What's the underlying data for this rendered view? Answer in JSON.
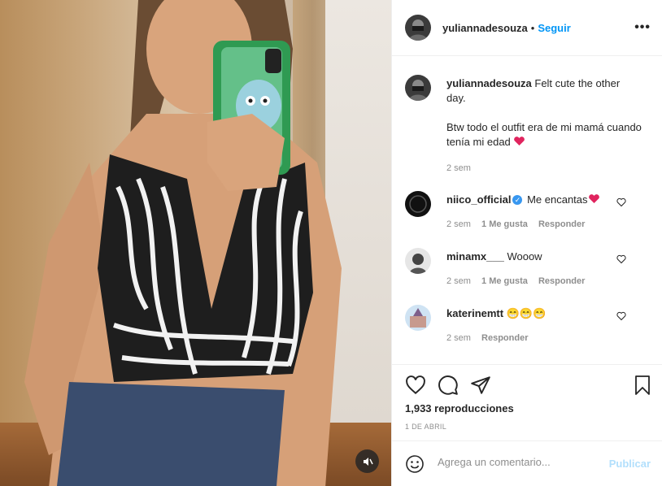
{
  "post": {
    "username": "yuliannadesouza",
    "separator": "•",
    "follow_label": "Seguir",
    "more_label": "•••"
  },
  "caption": {
    "username": "yuliannadesouza",
    "line1": "Felt cute the other day.",
    "line2": "Btw todo el outfit era de mi mamá cuando tenía mi edad",
    "time": "2 sem"
  },
  "comments": [
    {
      "username": "niico_official",
      "text": "Me encantas",
      "time": "2 sem",
      "likes": "1 Me gusta",
      "reply": "Responder",
      "verified_mark": "✓"
    },
    {
      "username": "minamx___",
      "text": "Wooow",
      "time": "2 sem",
      "likes": "1 Me gusta",
      "reply": "Responder"
    },
    {
      "username": "katerinemtt",
      "text": "😁😁😁",
      "time": "2 sem",
      "reply": "Responder"
    }
  ],
  "stats": {
    "views": "1,933 reproducciones",
    "date": "1 DE ABRIL"
  },
  "composer": {
    "placeholder": "Agrega un comentario...",
    "publish_label": "Publicar"
  },
  "colors": {
    "accent": "#0095f6",
    "publish_disabled": "#b2dffc",
    "muted": "#8e8e8e",
    "heart_emoji": "#e0245e"
  },
  "icons": [
    "mute-icon",
    "heart-icon",
    "comment-icon",
    "share-icon",
    "bookmark-icon",
    "emoji-icon",
    "like-comment-icon"
  ]
}
